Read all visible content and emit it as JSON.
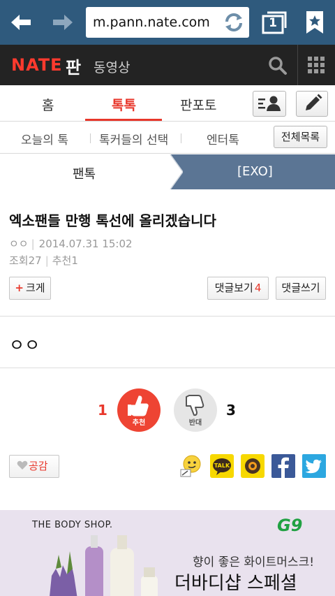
{
  "browser": {
    "url": "m.pann.nate.com",
    "tab_count": "1"
  },
  "header": {
    "logo": "NATE",
    "pan": "판",
    "video": "동영상"
  },
  "main_tabs": {
    "home": "홈",
    "toktok": "톡톡",
    "panpoto": "판포토"
  },
  "sub_tabs": {
    "today": "오늘의 톡",
    "choice": "톡커들의 선택",
    "entertainment": "엔터톡",
    "all_list": "전체목록"
  },
  "breadcrumb": {
    "left": "팬톡",
    "right": "[EXO]"
  },
  "article": {
    "title": "엑소팬들 만행 톡선에 올리겠습니다",
    "author": "ㅇㅇ",
    "date": "2014.07.31 15:02",
    "views": "조회27",
    "recommend": "추천1",
    "body": "ㅇㅇ"
  },
  "actions": {
    "bigger_plus": "+",
    "bigger": "크게",
    "view_comments": "댓글보기",
    "comment_count": "4",
    "write_comment": "댓글쓰기"
  },
  "votes": {
    "up_count": "1",
    "up_label": "추천",
    "down_label": "반대",
    "down_count": "3"
  },
  "share": {
    "empathy": "공감",
    "talk_label": "TALK"
  },
  "ad": {
    "brand": "THE BODY SHOP.",
    "g9": "G9",
    "line1": "향이 좋은 화이트머스크!",
    "line2": "더바디샵 스페셜"
  },
  "colors": {
    "browser_bar": "#2f5a7d",
    "header": "#232323",
    "accent": "#e8372b",
    "breadcrumb": "#5b7594",
    "facebook": "#3b5998",
    "twitter": "#2ca7e0",
    "kakao": "#f7d800"
  }
}
